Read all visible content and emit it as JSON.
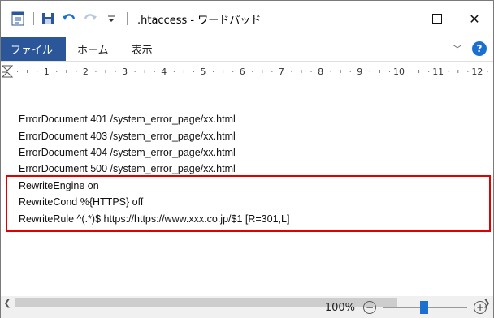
{
  "window": {
    "title": ".htaccess - ワードパッド",
    "close_glyph": "✕"
  },
  "ribbon": {
    "tabs": [
      {
        "label": "ファイル"
      },
      {
        "label": "ホーム"
      },
      {
        "label": "表示"
      }
    ]
  },
  "ruler": {
    "numbers": [
      "1",
      "2",
      "3",
      "4",
      "5",
      "6",
      "7",
      "8",
      "9",
      "10",
      "11",
      "12"
    ]
  },
  "document": {
    "lines": [
      "ErrorDocument 401 /system_error_page/xx.html",
      "ErrorDocument 403 /system_error_page/xx.html",
      "ErrorDocument 404 /system_error_page/xx.html",
      "ErrorDocument 500 /system_error_page/xx.html",
      "RewriteEngine on",
      "RewriteCond %{HTTPS} off",
      "RewriteRule ^(.*)$ https://https://www.xxx.co.jp/$1 [R=301,L]"
    ],
    "highlight_color": "#e00000"
  },
  "status": {
    "zoom": "100%",
    "zoom_level": 1.0
  },
  "colors": {
    "accent": "#2b579a",
    "help_blue": "#1a6fcf"
  }
}
